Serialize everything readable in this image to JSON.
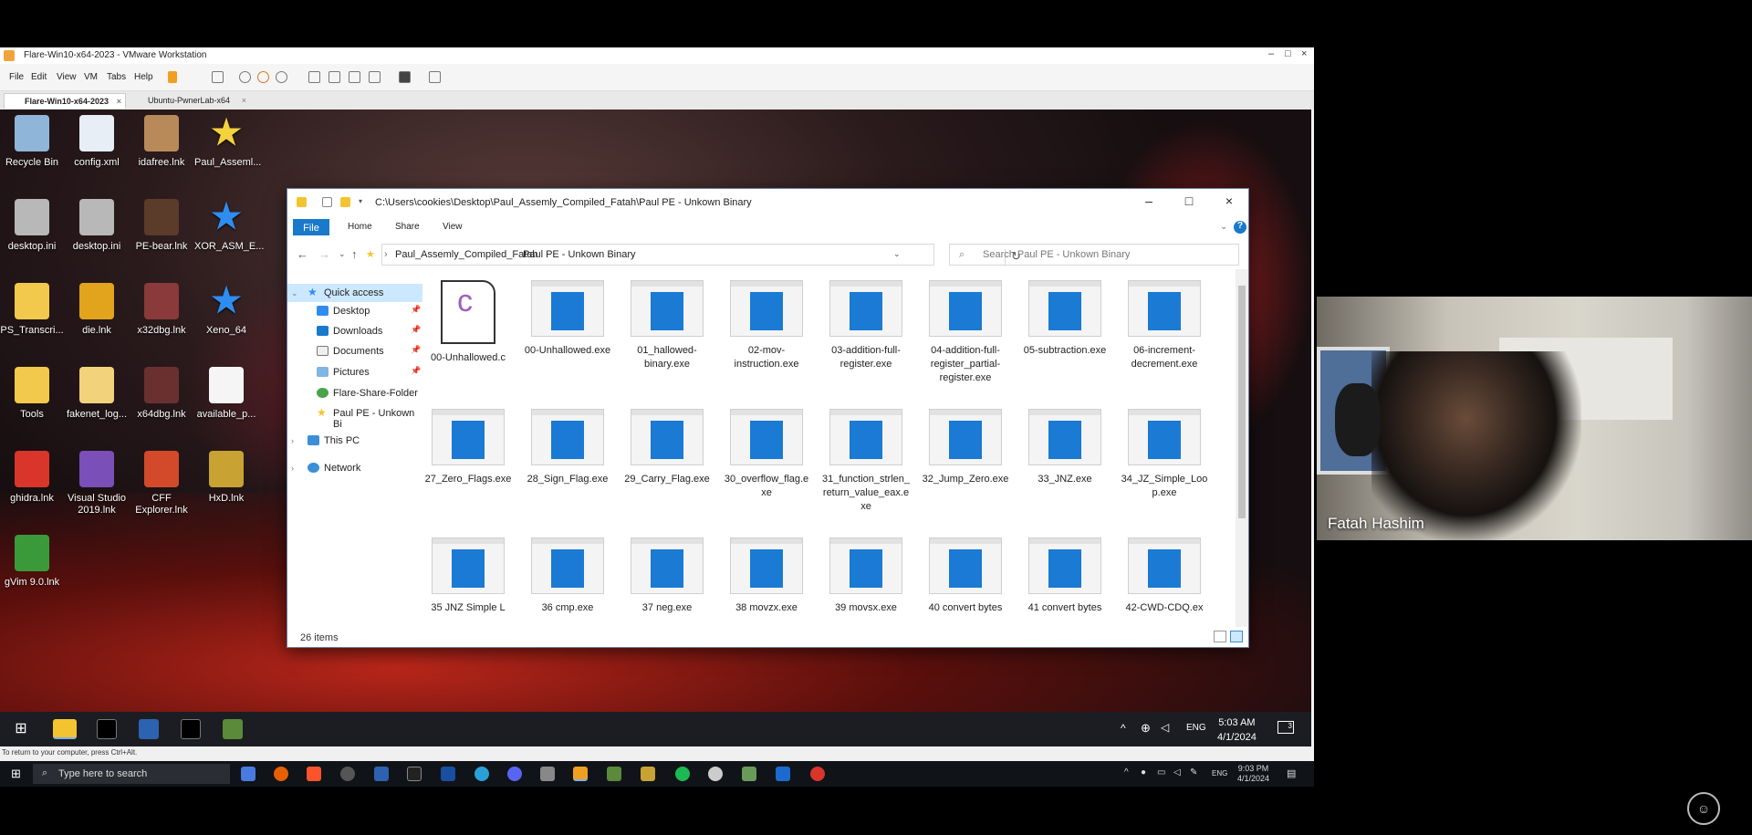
{
  "vmware": {
    "title": "Flare-Win10-x64-2023 - VMware Workstation",
    "menu": [
      "File",
      "Edit",
      "View",
      "VM",
      "Tabs",
      "Help"
    ],
    "tabs": [
      {
        "label": "Flare-Win10-x64-2023"
      },
      {
        "label": "Ubuntu-PwnerLab-x64"
      }
    ],
    "status_hint": "To return to your computer, press Ctrl+Alt."
  },
  "desktop_icons": [
    {
      "label": "Recycle Bin",
      "icon": "recycle-bin-icon",
      "color": "#8fb6d8"
    },
    {
      "label": "config.xml",
      "icon": "xml-file-icon",
      "color": "#e8eef5"
    },
    {
      "label": "idafree.lnk",
      "icon": "ida-icon",
      "color": "#b88a5a"
    },
    {
      "label": "Paul_Asseml...",
      "icon": "star-icon",
      "color": "#f4d23c"
    },
    {
      "label": "desktop.ini",
      "icon": "ini-file-icon",
      "color": "#b8b8b8"
    },
    {
      "label": "desktop.ini",
      "icon": "ini-file-icon",
      "color": "#b8b8b8"
    },
    {
      "label": "PE-bear.lnk",
      "icon": "pe-bear-icon",
      "color": "#5b3b2a"
    },
    {
      "label": "XOR_ASM_E...",
      "icon": "star-icon",
      "color": "#2f8df0"
    },
    {
      "label": "PS_Transcri...",
      "icon": "folder-icon",
      "color": "#f2c94c"
    },
    {
      "label": "die.lnk",
      "icon": "die-icon",
      "color": "#e2a41c"
    },
    {
      "label": "x32dbg.lnk",
      "icon": "bug-icon",
      "color": "#8a3a3a"
    },
    {
      "label": "Xeno_64",
      "icon": "star-icon",
      "color": "#2f8df0"
    },
    {
      "label": "Tools",
      "icon": "folder-icon",
      "color": "#f2c94c"
    },
    {
      "label": "fakenet_log...",
      "icon": "folder-icon",
      "color": "#f2d37c"
    },
    {
      "label": "x64dbg.lnk",
      "icon": "bug-icon",
      "color": "#6a3030"
    },
    {
      "label": "available_p...",
      "icon": "blank-file-icon",
      "color": "#f5f5f5"
    },
    {
      "label": "ghidra.lnk",
      "icon": "ghidra-icon",
      "color": "#d9352b"
    },
    {
      "label": "Visual Studio 2019.lnk",
      "icon": "visual-studio-icon",
      "color": "#7a4fb8"
    },
    {
      "label": "CFF Explorer.lnk",
      "icon": "cff-icon",
      "color": "#d24a2a"
    },
    {
      "label": "HxD.lnk",
      "icon": "hxd-icon",
      "color": "#c9a234"
    },
    {
      "label": "gVim 9.0.lnk",
      "icon": "gvim-icon",
      "color": "#3a9a3a"
    }
  ],
  "explorer": {
    "title_path": "C:\\Users\\cookies\\Desktop\\Paul_Assemly_Compiled_Fatah\\Paul PE - Unkown Binary",
    "ribbon_tabs": [
      "File",
      "Home",
      "Share",
      "View"
    ],
    "breadcrumb": [
      "Paul_Assemly_Compiled_Fatah",
      "Paul PE - Unkown Binary"
    ],
    "search_placeholder": "Search Paul PE - Unkown Binary",
    "nav": {
      "quick_access": "Quick access",
      "pinned": [
        "Desktop",
        "Downloads",
        "Documents",
        "Pictures"
      ],
      "other": [
        "Flare-Share-Folder",
        "Paul PE - Unkown Bi"
      ],
      "this_pc": "This PC",
      "network": "Network"
    },
    "files": [
      "00-Unhallowed.c",
      "00-Unhallowed.exe",
      "01_hallowed-binary.exe",
      "02-mov-instruction.exe",
      "03-addition-full-register.exe",
      "04-addition-full-register_partial-register.exe",
      "05-subtraction.exe",
      "06-increment-decrement.exe",
      "27_Zero_Flags.exe",
      "28_Sign_Flag.exe",
      "29_Carry_Flag.exe",
      "30_overflow_flag.exe",
      "31_function_strlen_return_value_eax.exe",
      "32_Jump_Zero.exe",
      "33_JNZ.exe",
      "34_JZ_Simple_Loop.exe",
      "35 JNZ Simple L",
      "36 cmp.exe",
      "37 neg.exe",
      "38 movzx.exe",
      "39 movsx.exe",
      "40 convert bytes",
      "41 convert bytes",
      "42-CWD-CDQ.ex"
    ],
    "item_count": "26 items"
  },
  "guest_taskbar": {
    "lang": "ENG",
    "time": "5:03 AM",
    "date": "4/1/2024",
    "notifications": "3"
  },
  "host_taskbar": {
    "search_placeholder": "Type here to search",
    "lang": "ENG",
    "time": "9:03 PM",
    "date": "4/1/2024"
  },
  "webcam": {
    "name": "Fatah Hashim"
  },
  "colors": {
    "accent": "#1979ca",
    "exe_blue": "#1a7ad4",
    "selection": "#cce8ff"
  }
}
